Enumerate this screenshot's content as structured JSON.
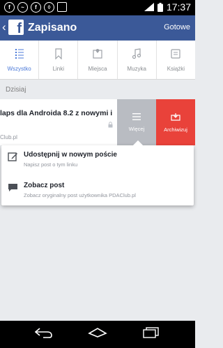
{
  "status_bar": {
    "time": "17:37",
    "notification_icons": [
      "facebook-icon",
      "messenger-icon",
      "facebook-icon",
      "shield-icon",
      "image-icon"
    ],
    "right_icons": [
      "signal-icon",
      "battery-icon"
    ]
  },
  "app_bar": {
    "title": "Zapisano",
    "done_label": "Gotowe"
  },
  "tabs": [
    {
      "label": "Wszystko",
      "icon": "list-icon",
      "active": true
    },
    {
      "label": "Linki",
      "icon": "bookmark-icon",
      "active": false
    },
    {
      "label": "Miejsca",
      "icon": "map-icon",
      "active": false
    },
    {
      "label": "Muzyka",
      "icon": "music-note-icon",
      "active": false
    },
    {
      "label": "Książki",
      "icon": "book-icon",
      "active": false
    }
  ],
  "section": {
    "label": "Dzisiaj"
  },
  "saved_item": {
    "title": "laps dla Androida 8.2 z nowymi i",
    "domain": "Club.pl",
    "more_label": "Więcej",
    "archive_label": "Archiwizuj"
  },
  "popup_menu": {
    "items": [
      {
        "title": "Udostępnij w nowym poście",
        "subtitle": "Napisz post o tym linku",
        "icon": "compose-icon"
      },
      {
        "title": "Zobacz post",
        "subtitle": "Zobacz oryginalny post użytkownika PDAClub.pl",
        "icon": "speech-bubble-icon"
      }
    ]
  },
  "colors": {
    "brand_blue": "#3b5998",
    "active_tab": "#4b79d8",
    "archive_red": "#e9423a",
    "more_gray": "#b9bcc2"
  }
}
